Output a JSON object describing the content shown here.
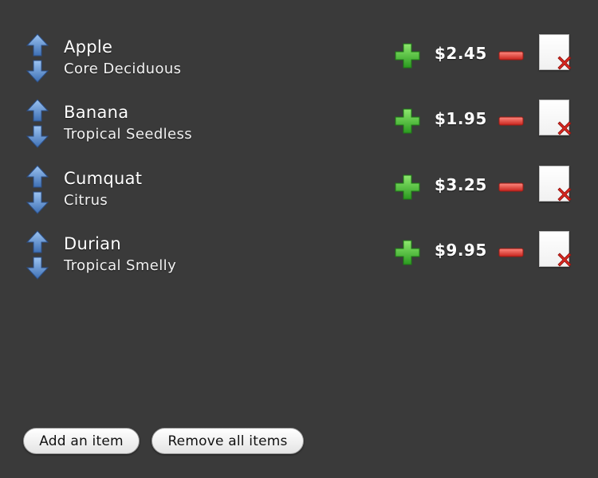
{
  "items": [
    {
      "name": "Apple",
      "description": "Core Deciduous",
      "price": "$2.45"
    },
    {
      "name": "Banana",
      "description": "Tropical Seedless",
      "price": "$1.95"
    },
    {
      "name": "Cumquat",
      "description": "Citrus",
      "price": "$3.25"
    },
    {
      "name": "Durian",
      "description": "Tropical Smelly",
      "price": "$9.95"
    }
  ],
  "actions": {
    "add_label": "Add an item",
    "remove_all_label": "Remove all items"
  },
  "icons": {
    "move_up": "arrow-up-icon",
    "move_down": "arrow-down-icon",
    "increase": "plus-icon",
    "decrease": "minus-icon",
    "delete": "delete-document-icon"
  },
  "colors": {
    "background": "#3a3a3a",
    "arrow": "#5d8fd0",
    "plus": "#3fbf2f",
    "minus": "#e0332a",
    "delete_x": "#d8261f"
  }
}
